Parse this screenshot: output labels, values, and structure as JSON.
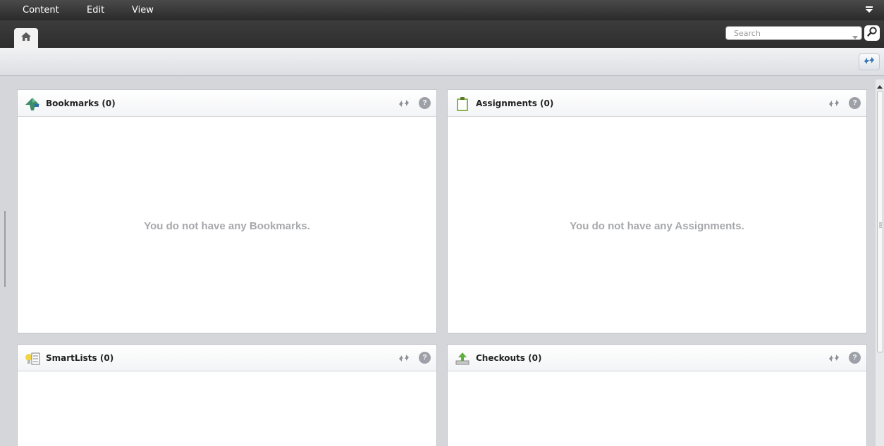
{
  "menubar": {
    "items": [
      "Content",
      "Edit",
      "View"
    ]
  },
  "search": {
    "placeholder": "Search"
  },
  "panels": [
    {
      "title": "Bookmarks (0)",
      "empty_text": "You do not have any Bookmarks.",
      "icon": "bookmark-icon"
    },
    {
      "title": "Assignments (0)",
      "empty_text": "You do not have any Assignments.",
      "icon": "clipboard-icon"
    },
    {
      "title": "SmartLists (0)",
      "empty_text": "",
      "icon": "smartlist-icon"
    },
    {
      "title": "Checkouts (0)",
      "empty_text": "",
      "icon": "checkout-icon"
    }
  ],
  "help_glyph": "?",
  "colors": {
    "menubar": "#2a2a2a",
    "accent_blue": "#3a78b8",
    "panel_bg": "#ffffff",
    "empty_text": "#a7a8ab"
  }
}
